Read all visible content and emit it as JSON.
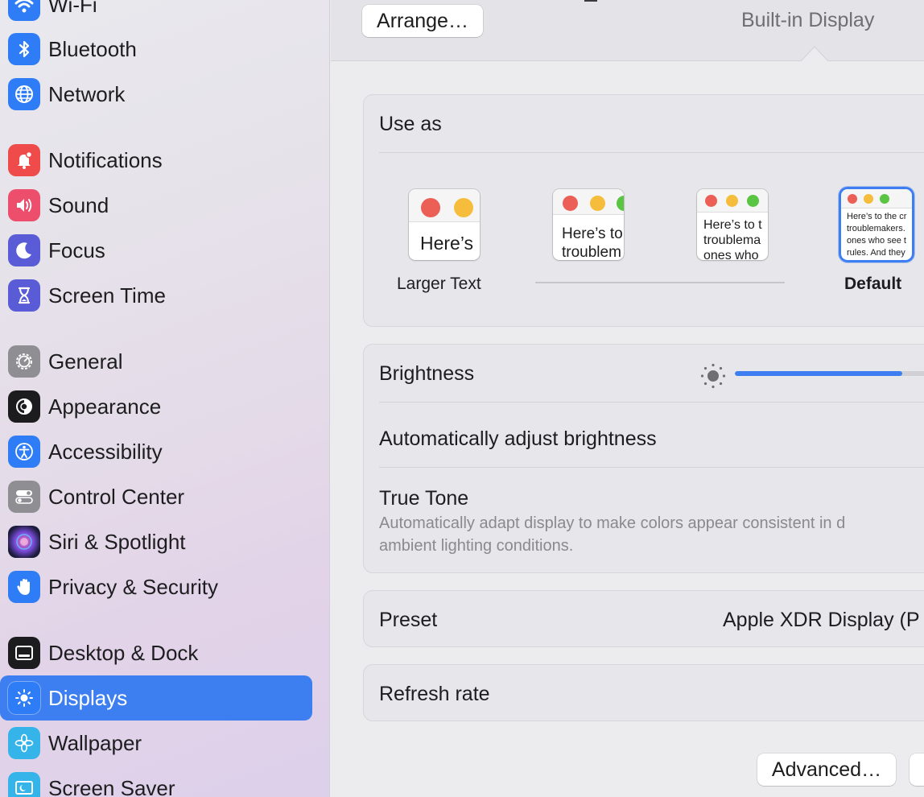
{
  "sidebar": {
    "items": [
      {
        "label": "Wi-Fi",
        "icon": "wifi-icon"
      },
      {
        "label": "Bluetooth",
        "icon": "bluetooth-icon"
      },
      {
        "label": "Network",
        "icon": "globe-icon"
      },
      {
        "label": "Notifications",
        "icon": "bell-icon"
      },
      {
        "label": "Sound",
        "icon": "speaker-icon"
      },
      {
        "label": "Focus",
        "icon": "moon-icon"
      },
      {
        "label": "Screen Time",
        "icon": "hourglass-icon"
      },
      {
        "label": "General",
        "icon": "gear-icon"
      },
      {
        "label": "Appearance",
        "icon": "appearance-icon"
      },
      {
        "label": "Accessibility",
        "icon": "accessibility-icon"
      },
      {
        "label": "Control Center",
        "icon": "toggles-icon"
      },
      {
        "label": "Siri & Spotlight",
        "icon": "siri-icon"
      },
      {
        "label": "Privacy & Security",
        "icon": "hand-icon"
      },
      {
        "label": "Desktop & Dock",
        "icon": "dock-icon"
      },
      {
        "label": "Displays",
        "icon": "sun-icon"
      },
      {
        "label": "Wallpaper",
        "icon": "flower-icon"
      },
      {
        "label": "Screen Saver",
        "icon": "screensaver-icon"
      }
    ],
    "selected": "Displays"
  },
  "toolbar": {
    "arrange_label": "Arrange…",
    "display_name": "Built-in Display"
  },
  "use_as": {
    "title": "Use as",
    "options": [
      {
        "preview_text": "Here’s",
        "label": "Larger Text"
      },
      {
        "preview_text_1": "Here’s to",
        "preview_text_2": "troublem"
      },
      {
        "preview_text_1": "Here’s to t",
        "preview_text_2": "troublema",
        "preview_text_3": "ones who"
      },
      {
        "preview_text_1": "Here’s to the cr",
        "preview_text_2": "troublemakers.",
        "preview_text_3": "ones who see t",
        "preview_text_4": "rules. And they",
        "label": "Default"
      }
    ]
  },
  "brightness": {
    "label": "Brightness",
    "level": 0.8
  },
  "auto_brightness": {
    "label": "Automatically adjust brightness"
  },
  "true_tone": {
    "label": "True Tone",
    "description_1": "Automatically adapt display to make colors appear consistent in d",
    "description_2": "ambient lighting conditions."
  },
  "preset": {
    "label": "Preset",
    "value": "Apple XDR Display (P"
  },
  "refresh": {
    "label": "Refresh rate"
  },
  "footer": {
    "advanced_label": "Advanced…"
  },
  "colors": {
    "accent": "#3d7ff0",
    "red_dot": "#ec5f57",
    "yellow_dot": "#f5bd3b",
    "green_dot": "#5ac443"
  }
}
